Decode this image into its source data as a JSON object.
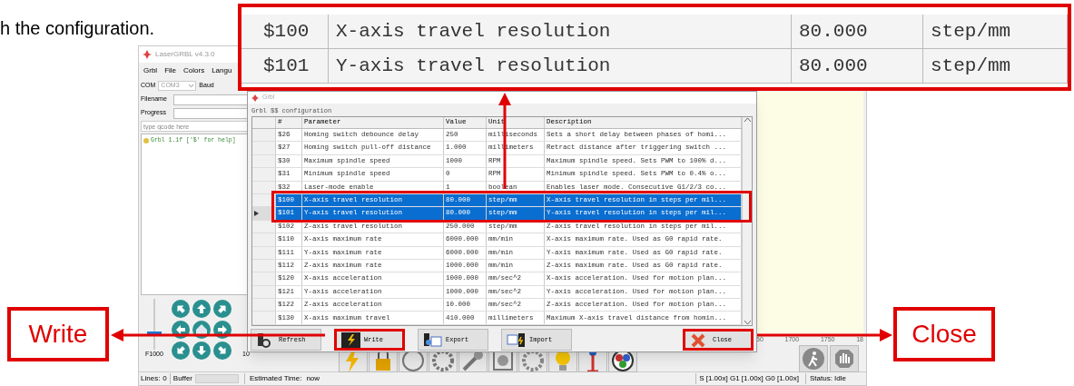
{
  "caption": "h the configuration.",
  "main_window": {
    "title": "LaserGRBL v4.3.0",
    "menu": [
      "Grbl",
      "File",
      "Colors",
      "Langu"
    ],
    "com_label": "COM",
    "com_value": "COM3",
    "baud_label": "Baud",
    "filename_label": "Filename",
    "progress_label": "Progress",
    "gcode_placeholder": "type gcode here",
    "console_lines": [
      "Grbl 1.1f ['$' for help]"
    ],
    "feed_slider": {
      "label": "F1000",
      "level": 0.3
    },
    "step_label": "10",
    "ruler_labels": [
      "50",
      "1700",
      "1750",
      "18"
    ]
  },
  "dialog": {
    "title": "Grbl",
    "group": "Grbl $$ configuration",
    "columns": [
      "#",
      "Parameter",
      "Value",
      "Unit",
      "Description"
    ],
    "rows": [
      {
        "number": "$26",
        "parameter": "Homing switch debounce delay",
        "value": "250",
        "unit": "milliseconds",
        "description": "Sets a short delay between phases of homi...",
        "selected": false,
        "current": false
      },
      {
        "number": "$27",
        "parameter": "Homing switch pull-off distance",
        "value": "1.000",
        "unit": "millimeters",
        "description": "Retract distance after triggering switch ...",
        "selected": false,
        "current": false
      },
      {
        "number": "$30",
        "parameter": "Maximum spindle speed",
        "value": "1000",
        "unit": "RPM",
        "description": "Maximum spindle speed. Sets PWM to 100% d...",
        "selected": false,
        "current": false
      },
      {
        "number": "$31",
        "parameter": "Minimum spindle speed",
        "value": "0",
        "unit": "RPM",
        "description": "Minimum spindle speed. Sets PWM to 0.4% o...",
        "selected": false,
        "current": false
      },
      {
        "number": "$32",
        "parameter": "Laser-mode enable",
        "value": "1",
        "unit": "boolean",
        "description": "Enables laser mode. Consecutive G1/2/3 co...",
        "selected": false,
        "current": false
      },
      {
        "number": "$100",
        "parameter": "X-axis travel resolution",
        "value": "80.000",
        "unit": "step/mm",
        "description": "X-axis travel resolution in steps per mil...",
        "selected": true,
        "current": false
      },
      {
        "number": "$101",
        "parameter": "Y-axis travel resolution",
        "value": "80.000",
        "unit": "step/mm",
        "description": "Y-axis travel resolution in steps per mil...",
        "selected": true,
        "current": true
      },
      {
        "number": "$102",
        "parameter": "Z-axis travel resolution",
        "value": "250.000",
        "unit": "step/mm",
        "description": "Z-axis travel resolution in steps per mil...",
        "selected": false,
        "current": false
      },
      {
        "number": "$110",
        "parameter": "X-axis maximum rate",
        "value": "6000.000",
        "unit": "mm/min",
        "description": "X-axis maximum rate. Used as G0 rapid rate.",
        "selected": false,
        "current": false
      },
      {
        "number": "$111",
        "parameter": "Y-axis maximum rate",
        "value": "6000.000",
        "unit": "mm/min",
        "description": "Y-axis maximum rate. Used as G0 rapid rate.",
        "selected": false,
        "current": false
      },
      {
        "number": "$112",
        "parameter": "Z-axis maximum rate",
        "value": "1000.000",
        "unit": "mm/min",
        "description": "Z-axis maximum rate. Used as G0 rapid rate.",
        "selected": false,
        "current": false
      },
      {
        "number": "$120",
        "parameter": "X-axis acceleration",
        "value": "1000.000",
        "unit": "mm/sec^2",
        "description": "X-axis acceleration. Used for motion plan...",
        "selected": false,
        "current": false
      },
      {
        "number": "$121",
        "parameter": "Y-axis acceleration",
        "value": "1000.000",
        "unit": "mm/sec^2",
        "description": "Y-axis acceleration. Used for motion plan...",
        "selected": false,
        "current": false
      },
      {
        "number": "$122",
        "parameter": "Z-axis acceleration",
        "value": "10.000",
        "unit": "mm/sec^2",
        "description": "Z-axis acceleration. Used for motion plan...",
        "selected": false,
        "current": false
      },
      {
        "number": "$130",
        "parameter": "X-axis maximum travel",
        "value": "410.000",
        "unit": "millimeters",
        "description": "Maximum X-axis travel distance from homin...",
        "selected": false,
        "current": false
      }
    ],
    "buttons": [
      {
        "label": "Refresh",
        "kind": "refresh",
        "highlighted": false
      },
      {
        "label": "Write",
        "kind": "write",
        "highlighted": true
      },
      {
        "label": "Export",
        "kind": "export",
        "highlighted": false
      },
      {
        "label": "Import",
        "kind": "import",
        "highlighted": false
      },
      {
        "label": "Close",
        "kind": "close",
        "highlighted": true
      }
    ]
  },
  "callout": {
    "rows": [
      {
        "number": "$100",
        "parameter": "X-axis travel resolution",
        "value": "80.000",
        "unit": "step/mm"
      },
      {
        "number": "$101",
        "parameter": "Y-axis travel resolution",
        "value": "80.000",
        "unit": "step/mm"
      }
    ]
  },
  "annotations": [
    {
      "label": "Write"
    },
    {
      "label": "Close"
    }
  ],
  "status_bar": {
    "lines_label": "Lines:",
    "lines_value": "0",
    "buffer": {
      "label": "Buffer",
      "level": 0
    },
    "time_label": "Estimated Time:",
    "time_value": "now",
    "overrides": "S [1.00x] G1 [1.00x] G0 [1.00x]",
    "status": "Status: Idle"
  }
}
